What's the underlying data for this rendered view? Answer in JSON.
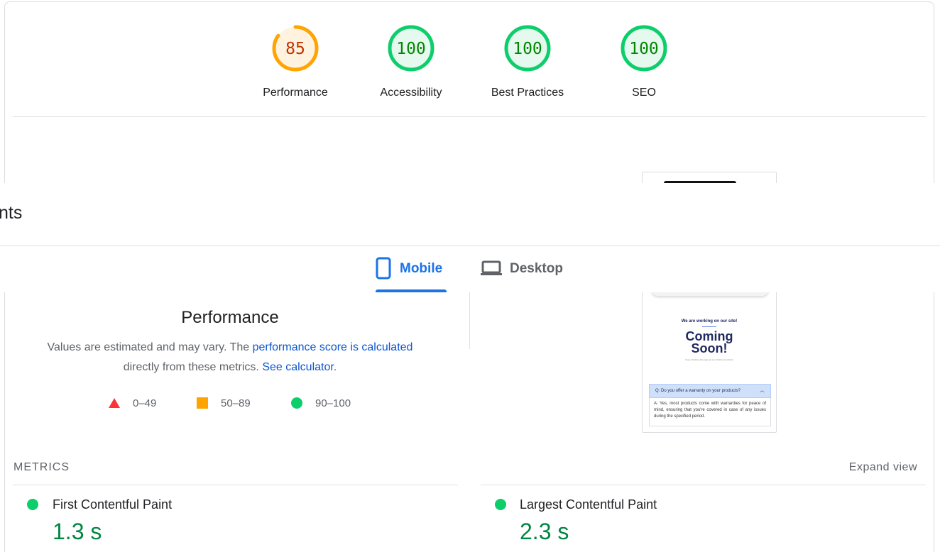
{
  "gauges": [
    {
      "score": "85",
      "label": "Performance",
      "value": 85,
      "status": "average",
      "ring_color": "#ffa400",
      "fill_color": "#fff3e0",
      "text_color": "#c33300"
    },
    {
      "score": "100",
      "label": "Accessibility",
      "value": 100,
      "status": "pass",
      "ring_color": "#0cce6b",
      "fill_color": "#e6f9ef",
      "text_color": "#008800"
    },
    {
      "score": "100",
      "label": "Best Practices",
      "value": 100,
      "status": "pass",
      "ring_color": "#0cce6b",
      "fill_color": "#e6f9ef",
      "text_color": "#008800"
    },
    {
      "score": "100",
      "label": "SEO",
      "value": 100,
      "status": "pass",
      "ring_color": "#0cce6b",
      "fill_color": "#e6f9ef",
      "text_color": "#008800"
    }
  ],
  "sticky": {
    "title_fragment": "nts"
  },
  "tabs": {
    "mobile": {
      "label": "Mobile",
      "icon": "smartphone-icon",
      "active": true
    },
    "desktop": {
      "label": "Desktop",
      "icon": "laptop-icon",
      "active": false
    }
  },
  "performance": {
    "title": "Performance",
    "desc_part1": "Values are estimated and may vary. The ",
    "link1": "performance score is calculated",
    "desc_part2": "directly from these metrics. ",
    "link2": "See calculator",
    "desc_end": "."
  },
  "legend": [
    {
      "range": "0–49",
      "shape": "triangle",
      "color": "#ff3333"
    },
    {
      "range": "50–89",
      "shape": "square",
      "color": "#ffa400"
    },
    {
      "range": "90–100",
      "shape": "circle",
      "color": "#0cce6b"
    }
  ],
  "screenshot": {
    "heading_small": "We are working on our site!",
    "heading_big_line1": "Coming",
    "heading_big_line2": "Soon!",
    "tagline": "Keep checking this page as we rebuild our website",
    "faq_question": "Q: Do you offer a warranty on your products?",
    "faq_answer": "A: Yes, most products come with warranties for peace of mind, ensuring that you're covered in case of any issues during the specified period."
  },
  "metrics": {
    "section_label": "METRICS",
    "expand_label": "Expand view",
    "items": [
      {
        "name": "First Contentful Paint",
        "value": "1.3 s",
        "status": "pass"
      },
      {
        "name": "Largest Contentful Paint",
        "value": "2.3 s",
        "status": "pass"
      }
    ]
  }
}
